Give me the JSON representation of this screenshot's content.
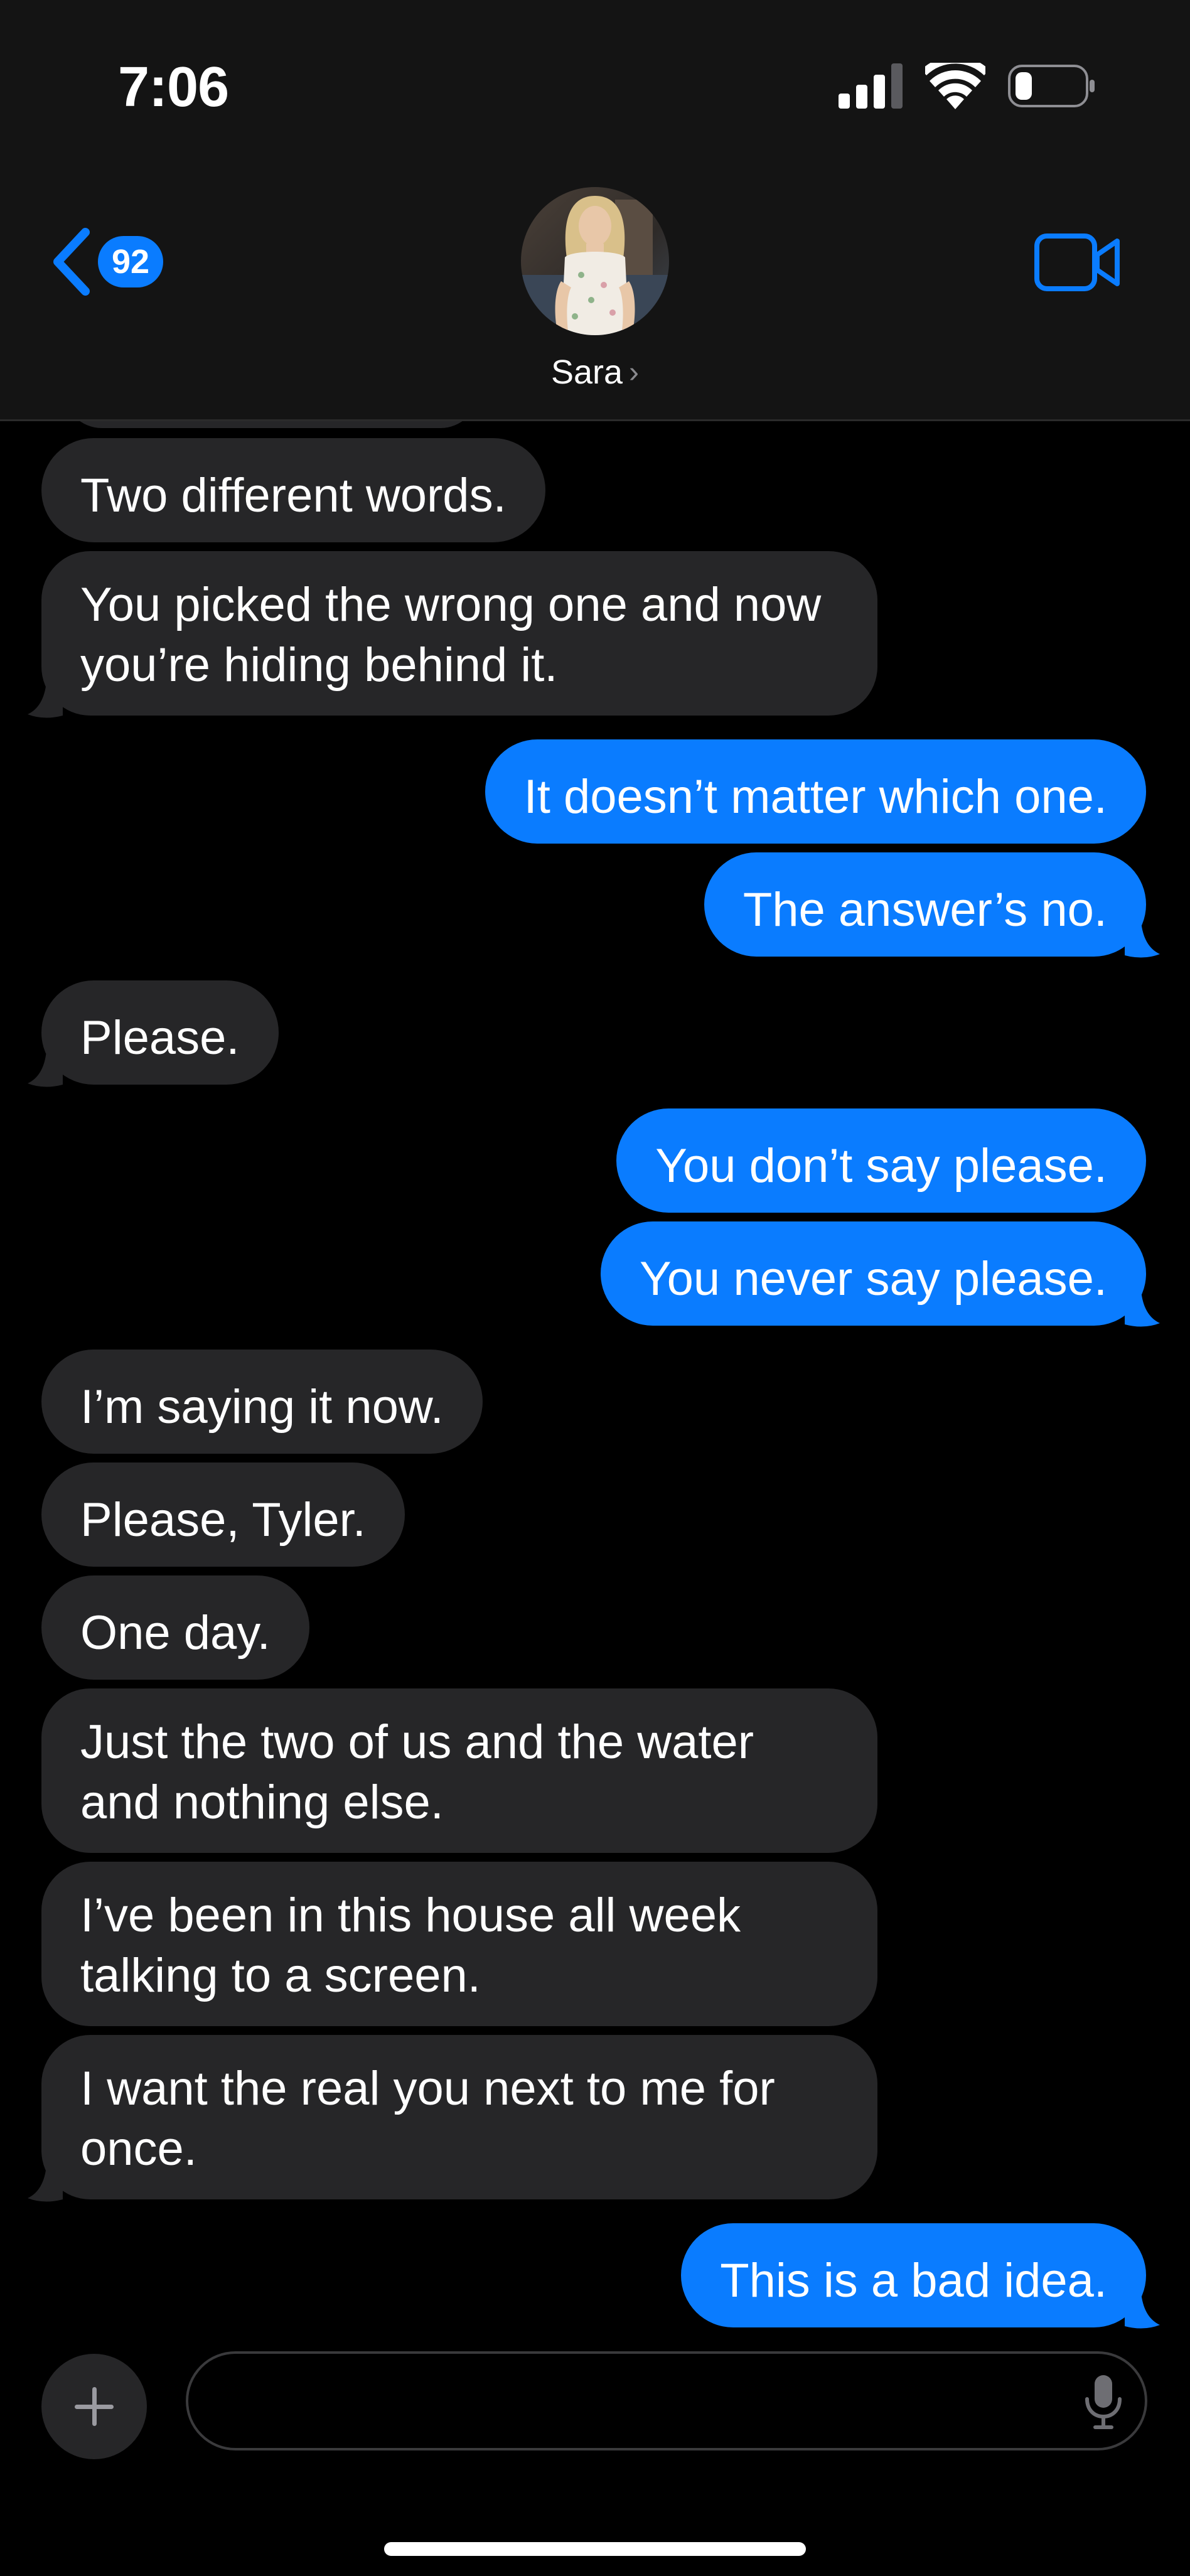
{
  "status_bar": {
    "time": "7:06",
    "icons": [
      "cellular-signal-icon",
      "wifi-icon",
      "battery-icon"
    ]
  },
  "header": {
    "back_badge": "92",
    "contact_name": "Sara",
    "video_icon": "video-camera-icon",
    "avatar": "contact-photo"
  },
  "messages": [
    {
      "side": "incoming",
      "text": "Two different words."
    },
    {
      "side": "incoming",
      "text": "You picked the wrong one and now you’re hiding behind it."
    },
    {
      "side": "outgoing",
      "text": "It doesn’t matter which one."
    },
    {
      "side": "outgoing",
      "text": "The answer’s no."
    },
    {
      "side": "incoming",
      "text": "Please."
    },
    {
      "side": "outgoing",
      "text": "You don’t say please."
    },
    {
      "side": "outgoing",
      "text": "You never say please."
    },
    {
      "side": "incoming",
      "text": "I’m saying it now."
    },
    {
      "side": "incoming",
      "text": "Please, Tyler."
    },
    {
      "side": "incoming",
      "text": "One day."
    },
    {
      "side": "incoming",
      "text": "Just the two of us and the water and nothing else."
    },
    {
      "side": "incoming",
      "text": "I’ve been in this house all week talking to a screen."
    },
    {
      "side": "incoming",
      "text": "I want the real you next to me for once."
    },
    {
      "side": "outgoing",
      "text": "This is a bad idea."
    }
  ],
  "compose": {
    "value": "",
    "placeholder": ""
  },
  "colors": {
    "outgoing_bubble": "#0a7cff",
    "incoming_bubble": "#262628",
    "header_bg": "#141414",
    "accent": "#0a7cff"
  }
}
